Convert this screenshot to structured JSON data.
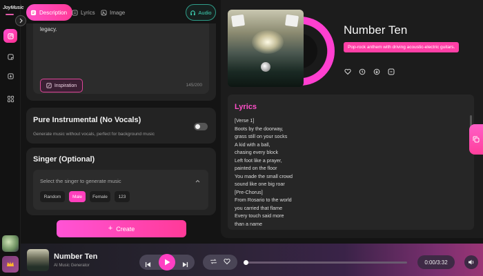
{
  "app": {
    "logo_text": "JoyMusic",
    "accent": "#ff3fc3",
    "sidebar_icons": [
      "music-icon",
      "note-icon",
      "download-icon",
      "grid-icon"
    ]
  },
  "tabs": [
    {
      "label": "Description",
      "active": true,
      "icon": "description-icon"
    },
    {
      "label": "Lyrics",
      "active": false,
      "icon": "lyrics-icon"
    },
    {
      "label": "Image",
      "active": false,
      "icon": "image-icon"
    }
  ],
  "audio_tab": {
    "label": "Audio",
    "icon": "audio-icon"
  },
  "description": {
    "text": "legacy.",
    "inspiration_label": "Inspiration",
    "counter": "145/200"
  },
  "instrumental": {
    "title": "Pure Instrumental (No Vocals)",
    "subtitle": "Generate music without vocals, perfect for background music",
    "enabled": false
  },
  "singer": {
    "title": "Singer (Optional)",
    "placeholder": "Select the singer to generate music",
    "options": [
      {
        "label": "Random",
        "active": false
      },
      {
        "label": "Male",
        "active": true
      },
      {
        "label": "Female",
        "active": false
      },
      {
        "label": "123",
        "active": false
      }
    ]
  },
  "create_label": "Create",
  "song": {
    "title": "Number Ten",
    "tag": "Pop-rock anthem with driving acoustic-electric guitars.",
    "actions": [
      "heart-icon",
      "share-icon",
      "download-icon",
      "more-icon"
    ]
  },
  "lyrics": {
    "title": "Lyrics",
    "lines": [
      "[Verse 1]",
      "Boots by the doorway,",
      "grass still on your socks",
      "A kid with a ball,",
      "chasing every block",
      "Left foot like a prayer,",
      "painted on the floor",
      "You made the small crowd",
      "sound like one big roar",
      "[Pre-Chorus]",
      "From Rosario to the world",
      "you carried that flame",
      "Every touch said more",
      "than a name"
    ]
  },
  "player": {
    "title": "Number Ten",
    "subtitle": "AI Music Generator",
    "time": "0:00/3:32",
    "progress": 0.0
  }
}
